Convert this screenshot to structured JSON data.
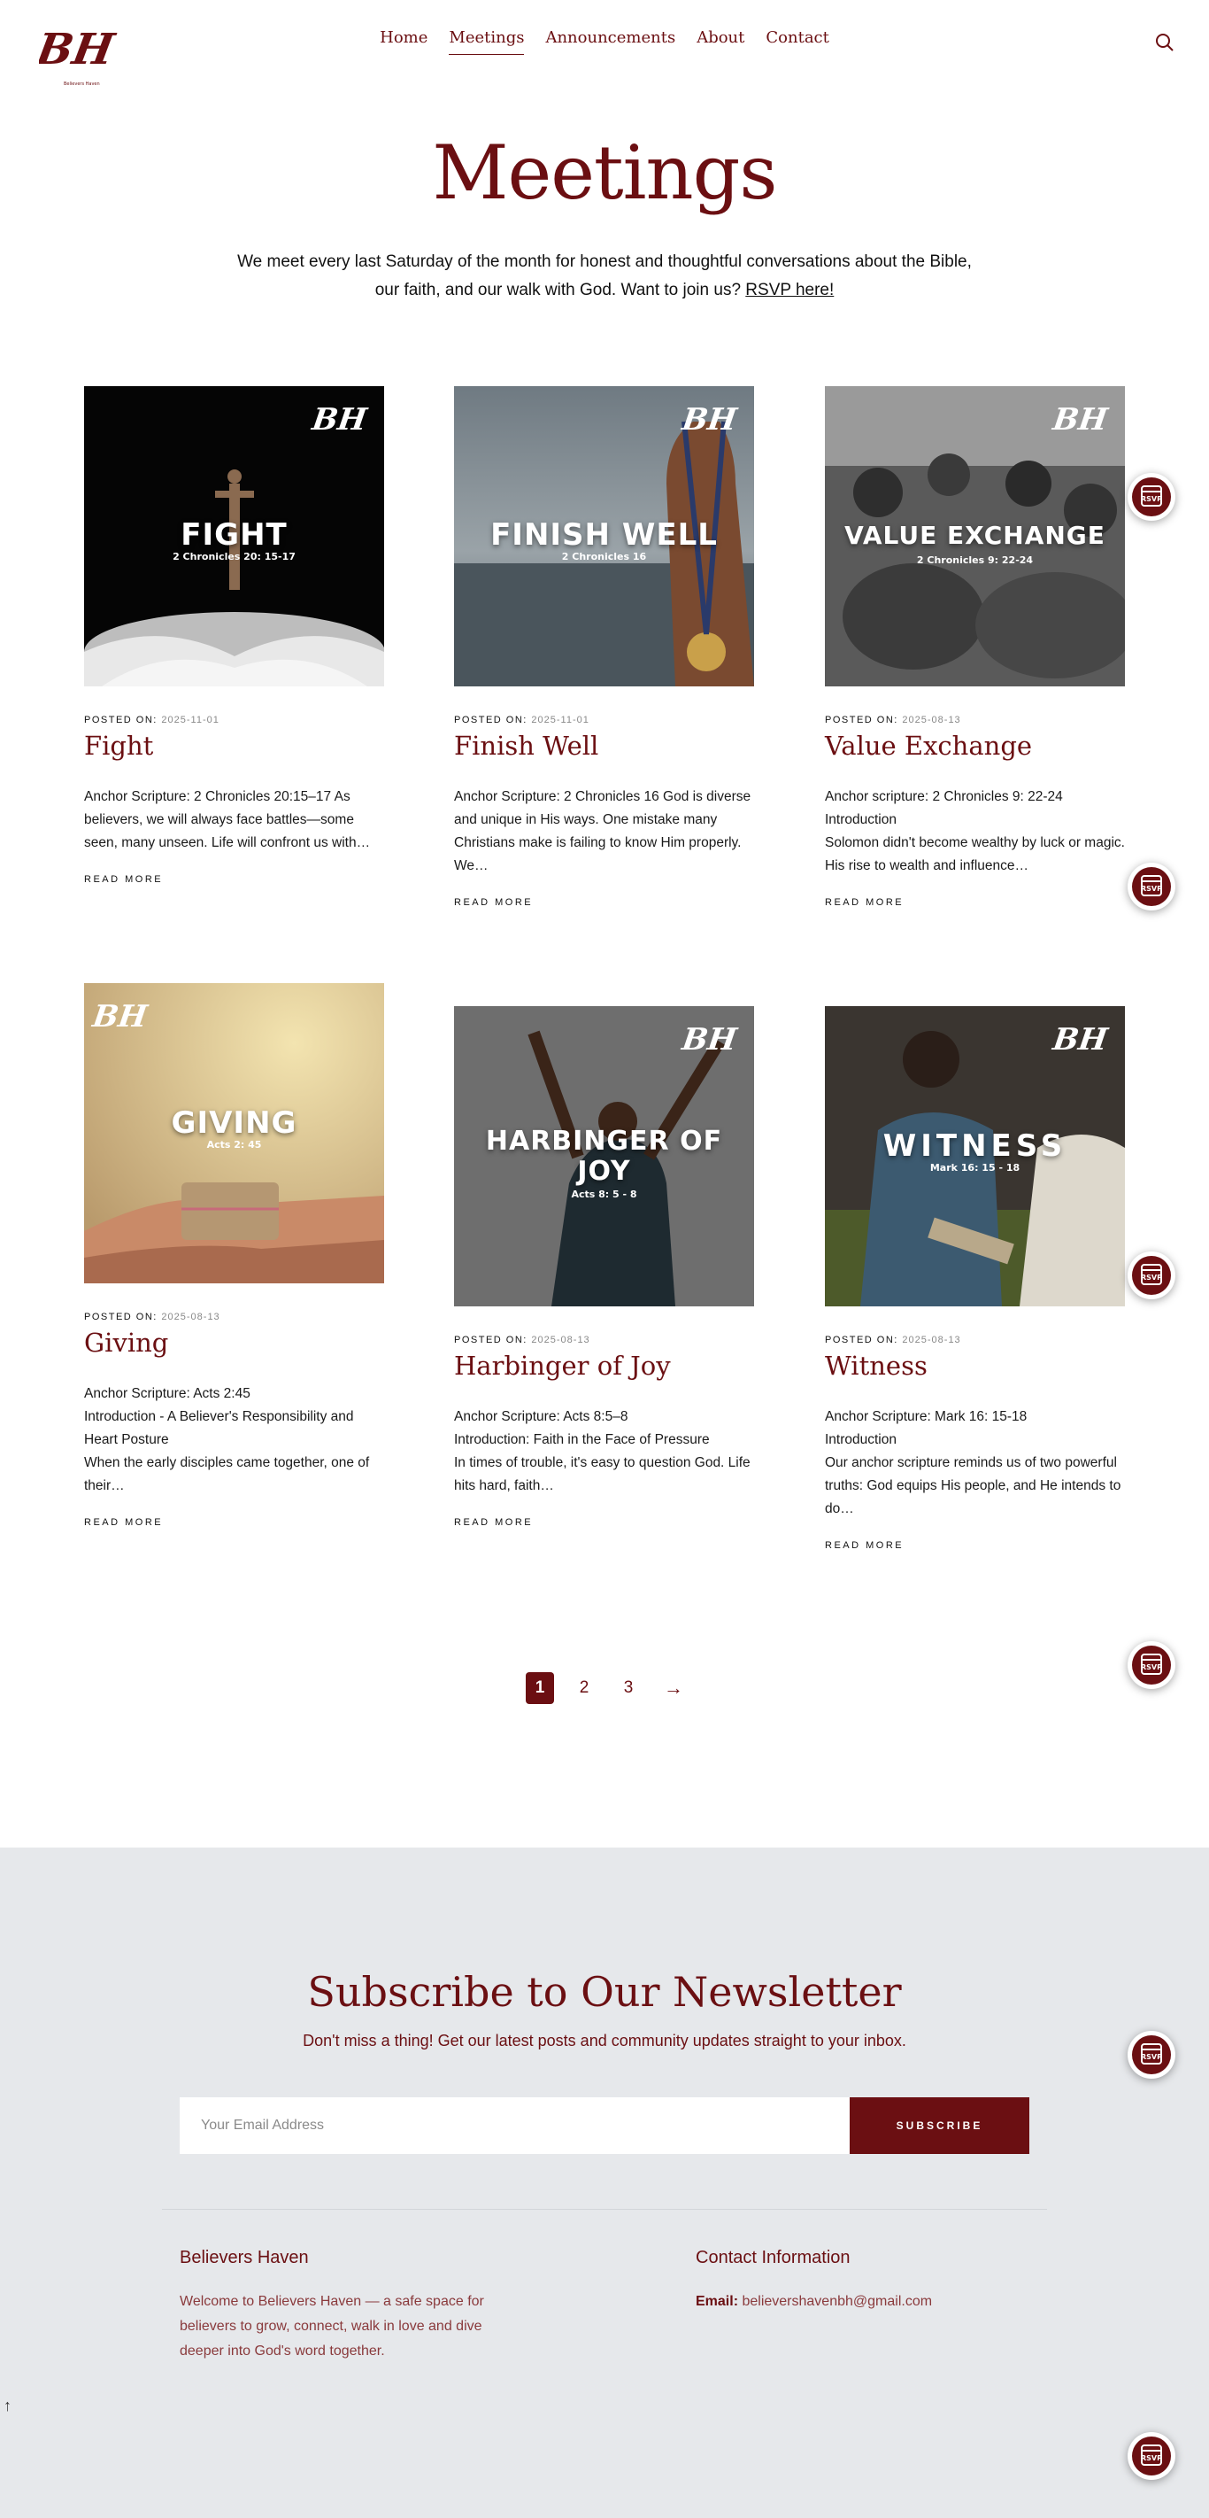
{
  "nav": {
    "items": [
      "Home",
      "Meetings",
      "Announcements",
      "About",
      "Contact"
    ],
    "active": "Meetings"
  },
  "logo": {
    "text": "BH",
    "tagline": "Believers Haven"
  },
  "colors": {
    "brand": "#6b0f12",
    "footer_bg": "#e6e8eb"
  },
  "hero": {
    "title": "Meetings",
    "intro_prefix": "We meet every last Saturday of the month for honest and thoughtful conversations about the Bible, our faith, and our walk with God. Want to join us?",
    "rsvp_link": "RSVP here!"
  },
  "posts": [
    {
      "image_title": "FIGHT",
      "image_sub": "2 Chronicles 20: 15-17",
      "posted_label": "POSTED ON:",
      "date": "2025-11-01",
      "title": "Fight",
      "excerpt": "Anchor Scripture: 2 Chronicles 20:15–17 As believers, we will always face battles—some seen, many unseen. Life will confront us with…",
      "read_more": "READ MORE"
    },
    {
      "image_title": "FINISH WELL",
      "image_sub": "2 Chronicles 16",
      "posted_label": "POSTED ON:",
      "date": "2025-11-01",
      "title": "Finish Well",
      "excerpt": "Anchor Scripture: 2 Chronicles 16 God is diverse and unique in His ways. One mistake many Christians make is failing to know Him properly. We…",
      "read_more": "READ MORE"
    },
    {
      "image_title": "VALUE EXCHANGE",
      "image_sub": "2 Chronicles 9: 22-24",
      "posted_label": "POSTED ON:",
      "date": "2025-08-13",
      "title": "Value Exchange",
      "excerpt": "Anchor scripture: 2 Chronicles 9: 22-24\n Introduction\nSolomon didn't become wealthy by luck or magic. His rise to wealth and influence…",
      "read_more": "READ MORE"
    },
    {
      "image_title": "GIVING",
      "image_sub": "Acts 2: 45",
      "posted_label": "POSTED ON:",
      "date": "2025-08-13",
      "title": "Giving",
      "excerpt": "Anchor Scripture: Acts 2:45\n Introduction - A Believer's Responsibility and Heart Posture\nWhen the early disciples came together, one of their…",
      "read_more": "READ MORE"
    },
    {
      "image_title": "HARBINGER OF JOY",
      "image_sub": "Acts 8: 5 - 8",
      "posted_label": "POSTED ON:",
      "date": "2025-08-13",
      "title": "Harbinger of Joy",
      "excerpt": "Anchor Scripture: Acts 8:5–8\nIntroduction: Faith in the Face of Pressure\nIn times of trouble, it's easy to question God. Life hits hard, faith…",
      "read_more": "READ MORE"
    },
    {
      "image_title": "WITNESS",
      "image_sub": "Mark 16: 15 - 18",
      "posted_label": "POSTED ON:",
      "date": "2025-08-13",
      "title": "Witness",
      "excerpt": "Anchor Scripture: Mark 16: 15-18\nIntroduction\nOur anchor scripture reminds us of two powerful truths: God equips His people, and He intends to do…",
      "read_more": "READ MORE"
    }
  ],
  "pagination": {
    "pages": [
      "1",
      "2",
      "3"
    ],
    "current": "1",
    "next": "→"
  },
  "newsletter": {
    "title": "Subscribe to Our Newsletter",
    "subtitle": "Don't miss a thing! Get our latest posts and community updates straight to your inbox.",
    "placeholder": "Your Email Address",
    "button": "SUBSCRIBE"
  },
  "footer": {
    "about_title": "Believers Haven",
    "about_text": "Welcome to Believers Haven — a safe space for believers to grow, connect, walk in love and dive deeper into God's word together.",
    "contact_title": "Contact Information",
    "email_label": "Email:",
    "email": "believershavenbh@gmail.com"
  },
  "rsvp_badge": "RSVP",
  "back_to_top": "↑"
}
